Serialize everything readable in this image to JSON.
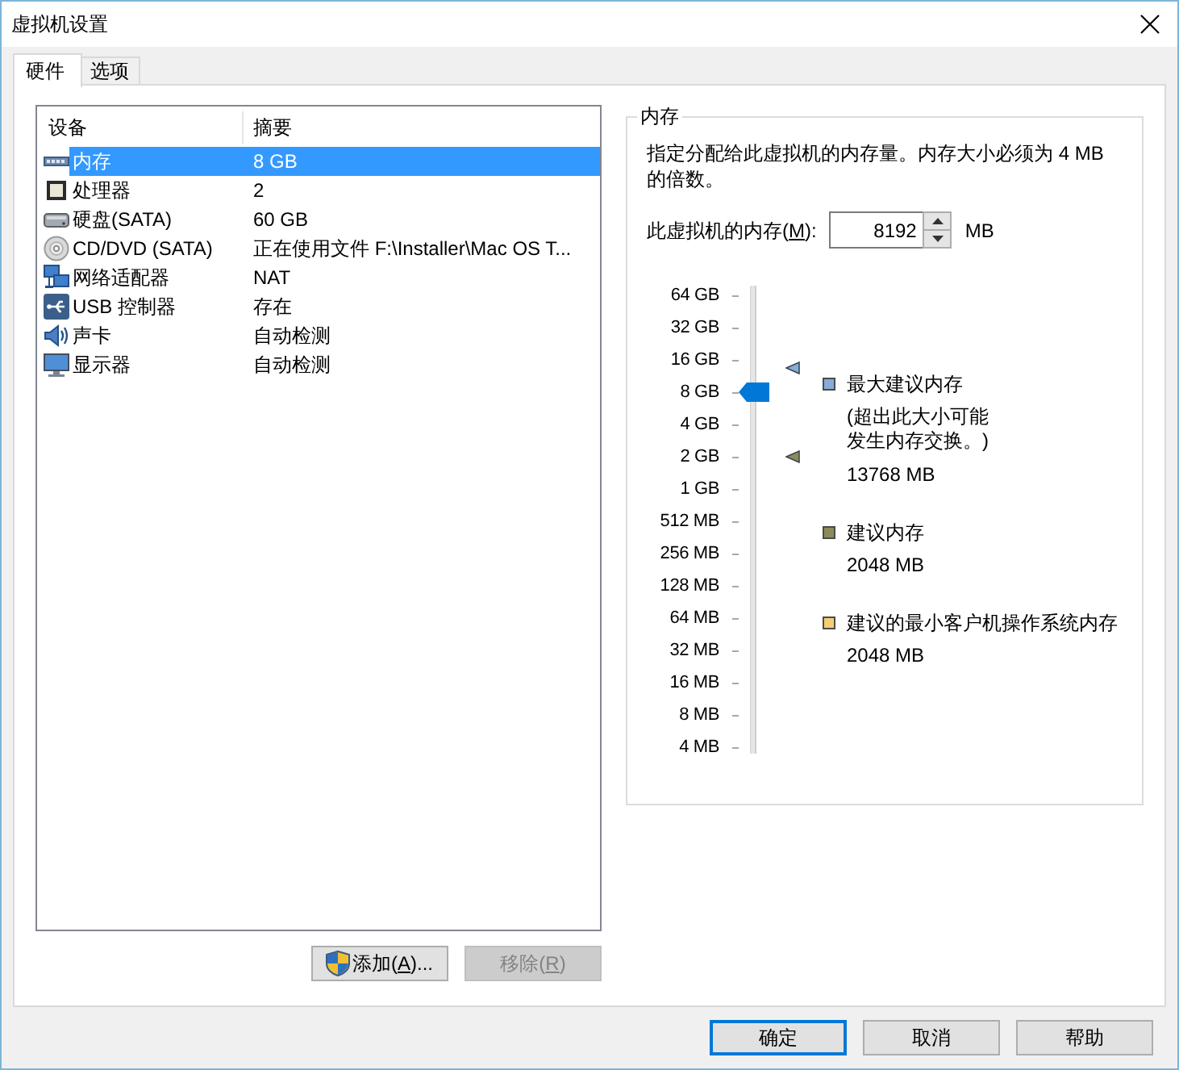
{
  "window": {
    "title": "虚拟机设置"
  },
  "tabs": [
    {
      "label": "硬件",
      "selected": true
    },
    {
      "label": "选项",
      "selected": false
    }
  ],
  "devices": {
    "columns": [
      "设备",
      "摘要"
    ],
    "rows": [
      {
        "kind": "memory",
        "name": "内存",
        "summary": "8 GB",
        "selected": true
      },
      {
        "kind": "processor",
        "name": "处理器",
        "summary": "2",
        "selected": false
      },
      {
        "kind": "disk",
        "name": "硬盘(SATA)",
        "summary": "60 GB",
        "selected": false
      },
      {
        "kind": "cdrom",
        "name": "CD/DVD (SATA)",
        "summary": "正在使用文件 F:\\Installer\\Mac OS T...",
        "selected": false
      },
      {
        "kind": "network",
        "name": "网络适配器",
        "summary": "NAT",
        "selected": false
      },
      {
        "kind": "usb",
        "name": "USB 控制器",
        "summary": "存在",
        "selected": false
      },
      {
        "kind": "sound",
        "name": "声卡",
        "summary": "自动检测",
        "selected": false
      },
      {
        "kind": "display",
        "name": "显示器",
        "summary": "自动检测",
        "selected": false
      }
    ]
  },
  "device_buttons": [
    {
      "label": "添加(",
      "access_key": "A",
      "label_end": ")...",
      "disabled": false,
      "shield": true
    },
    {
      "label": "移除(",
      "access_key": "R",
      "label_end": ")",
      "disabled": true,
      "shield": false
    }
  ],
  "memory": {
    "title": "内存",
    "description": "指定分配给此虚拟机的内存量。内存大小必须为 4 MB 的倍数。",
    "field": {
      "label": "此虚拟机的内存(",
      "access_key": "M",
      "label_end": "):",
      "value": "8192",
      "unit": "MB"
    },
    "slider": {
      "ticks": [
        "64 GB",
        "32 GB",
        "16 GB",
        "8 GB",
        "4 GB",
        "2 GB",
        "1 GB",
        "512 MB",
        "256 MB",
        "128 MB",
        "64 MB",
        "32 MB",
        "16 MB",
        "8 MB",
        "4 MB"
      ],
      "level": 0.7857,
      "markers": [
        {
          "level": 0.8392,
          "color": "#86acd9"
        },
        {
          "level": 0.6429,
          "color": "#8c8c5a"
        }
      ]
    },
    "legend": [
      {
        "label": "最大建议内存",
        "note": "(超出此大小可能发生内存交换。)",
        "value": "13768 MB",
        "color": "#86acd9"
      },
      {
        "label": "建议内存",
        "value": "2048 MB",
        "color": "#8c8c5a"
      },
      {
        "label": "建议的最小客户机操作系统内存",
        "value": "2048 MB",
        "color": "#f6cf74"
      }
    ]
  },
  "footer_buttons": [
    {
      "label": "确定",
      "default": true
    },
    {
      "label": "取消",
      "default": false
    },
    {
      "label": "帮助",
      "default": false
    }
  ]
}
